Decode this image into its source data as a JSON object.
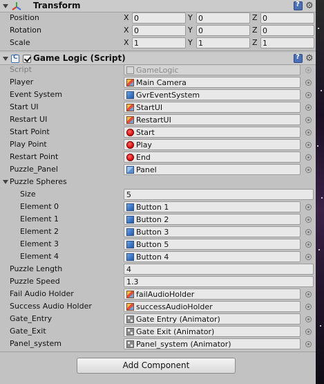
{
  "transform": {
    "title": "Transform",
    "position": {
      "label": "Position",
      "x": "0",
      "y": "0",
      "z": "0"
    },
    "rotation": {
      "label": "Rotation",
      "x": "0",
      "y": "0",
      "z": "0"
    },
    "scale": {
      "label": "Scale",
      "x": "1",
      "y": "1",
      "z": "1"
    },
    "axes": {
      "x": "X",
      "y": "Y",
      "z": "Z"
    }
  },
  "game_logic": {
    "title": "Game Logic (Script)",
    "enabled": true,
    "script": {
      "label": "Script",
      "value": "GameLogic"
    },
    "fields": [
      {
        "label": "Player",
        "value": "Main Camera",
        "icon": "prefab-icon"
      },
      {
        "label": "Event System",
        "value": "GvrEventSystem",
        "icon": "cube-icon"
      },
      {
        "label": "Start UI",
        "value": "StartUI",
        "icon": "prefab-icon"
      },
      {
        "label": "Restart UI",
        "value": "RestartUI",
        "icon": "prefab-icon"
      },
      {
        "label": "Start Point",
        "value": "Start",
        "icon": "record-icon"
      },
      {
        "label": "Play Point",
        "value": "Play",
        "icon": "record-icon"
      },
      {
        "label": "Restart Point",
        "value": "End",
        "icon": "record-icon"
      },
      {
        "label": "Puzzle_Panel",
        "value": "Panel",
        "icon": "panel-icon"
      }
    ],
    "puzzle_spheres": {
      "label": "Puzzle Spheres",
      "size_label": "Size",
      "size": "5",
      "elements": [
        {
          "label": "Element 0",
          "value": "Button 1"
        },
        {
          "label": "Element 1",
          "value": "Button 2"
        },
        {
          "label": "Element 2",
          "value": "Button 3"
        },
        {
          "label": "Element 3",
          "value": "Button 5"
        },
        {
          "label": "Element 4",
          "value": "Button 4"
        }
      ]
    },
    "puzzle_length": {
      "label": "Puzzle Length",
      "value": "4"
    },
    "puzzle_speed": {
      "label": "Puzzle Speed",
      "value": "1.3"
    },
    "refs": [
      {
        "label": "Fail Audio Holder",
        "value": "failAudioHolder",
        "icon": "prefab-icon"
      },
      {
        "label": "Success Audio Holder",
        "value": "successAudioHolder",
        "icon": "prefab-icon"
      },
      {
        "label": "Gate_Entry",
        "value": "Gate Entry (Animator)",
        "icon": "animator-icon"
      },
      {
        "label": "Gate_Exit",
        "value": "Gate Exit (Animator)",
        "icon": "animator-icon"
      },
      {
        "label": "Panel_system",
        "value": "Panel_system (Animator)",
        "icon": "animator-icon"
      }
    ]
  },
  "add_component_label": "Add Component"
}
